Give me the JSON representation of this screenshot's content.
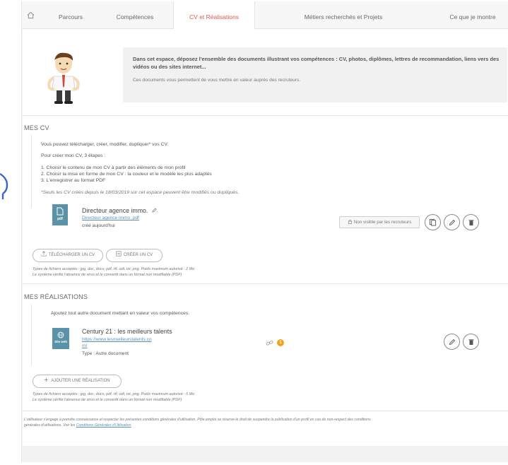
{
  "nav": {
    "tabs": [
      {
        "label": "Parcours"
      },
      {
        "label": "Compétences"
      },
      {
        "label": "CV et Réalisations"
      },
      {
        "label": "Métiers recherchés et Projets"
      },
      {
        "label": "Ce que je montre"
      }
    ],
    "active_tab": "CV et Réalisations"
  },
  "intro": {
    "bold": "Dans cet espace, déposez l'ensemble des documents illustrant vos compétences : CV, photos, diplômes, lettres de recommandation, liens vers des vidéos ou des sites internet...",
    "text": "Ces documents vous permettent de vous mettre en valeur auprès des recruteurs."
  },
  "mes_cv": {
    "title": "MES CV",
    "line1": "Vous pouvez télécharger, créer, modifier, dupliquer* vos CV.",
    "line2": "Pour créer mon CV, 3 étapes :",
    "steps": [
      "1. Choisir le contenu de mon CV à partir des éléments de mon profil",
      "2. Choisir la mise en forme de mon CV : la couleur et le modèle les plus adaptés",
      "3. L'enregistrer au format PDF"
    ],
    "note": "*Seuls les CV créés depuis le 18/03/2019 sur cet espace peuvent être modifiés ou dupliqués.",
    "doc": {
      "icon_label": "pdf",
      "title": "Directeur agence immo.",
      "link": "Directeur agence immo .pdf",
      "created": "créé aujourd'hui",
      "visibility": "Non visible par les recruteurs"
    },
    "btn_upload": "TÉLÉCHARGER UN CV",
    "btn_create": "CRÉER UN CV",
    "types_note": "Types de fichiers acceptés : jpg, doc, docx, pdf, rtf, odt, txt, png. Poids maximum autorisé : 2 Mo",
    "virus_note": "Le système vérifie l'absence de virus et le convertit dans un format non modifiable (PDF)"
  },
  "mes_realisations": {
    "title": "MES RÉALISATIONS",
    "intro": "Ajoutez tout autre document mettant en valeur vos compétences.",
    "item": {
      "icon_label": "Site web",
      "title": "Century 21 : les meilleurs talents",
      "link_line1": "https://www.lesmeilleurstalents.co",
      "link_line2": "m/",
      "type": "Type : Autre document",
      "count": "1"
    },
    "btn_add": "AJOUTER UNE RÉALISATION",
    "types_note": "Types de fichiers acceptés : jpg, doc, docx, pdf, rtf, odt, txt, png. Poids maximum autorisé : 5 Mo",
    "virus_note": "Le système vérifie l'absence de virus et le convertit dans un format non modifiable (PDF)"
  },
  "footer": {
    "line1": "L'utilisateur s'engage à prendre connaissance et respecter les présentes conditions générales d'utilisation. Pôle emploi se réserve le droit de suspendre la publication d'un profil en cas de non-respect des conditions",
    "line2_prefix": "générales d'utilisations. Voir les",
    "line2_link": "Conditions Générales d'Utilisation"
  },
  "colors": {
    "accent": "#e2554d",
    "link": "#5c8fb6",
    "doc_icon": "#5a93a8",
    "badge": "#f4a21c"
  },
  "icons": [
    "home-icon",
    "lock-icon",
    "duplicate-icon",
    "pencil-icon",
    "trash-icon",
    "upload-icon",
    "create-cv-icon",
    "globe-icon",
    "link-icon",
    "plus-icon"
  ]
}
